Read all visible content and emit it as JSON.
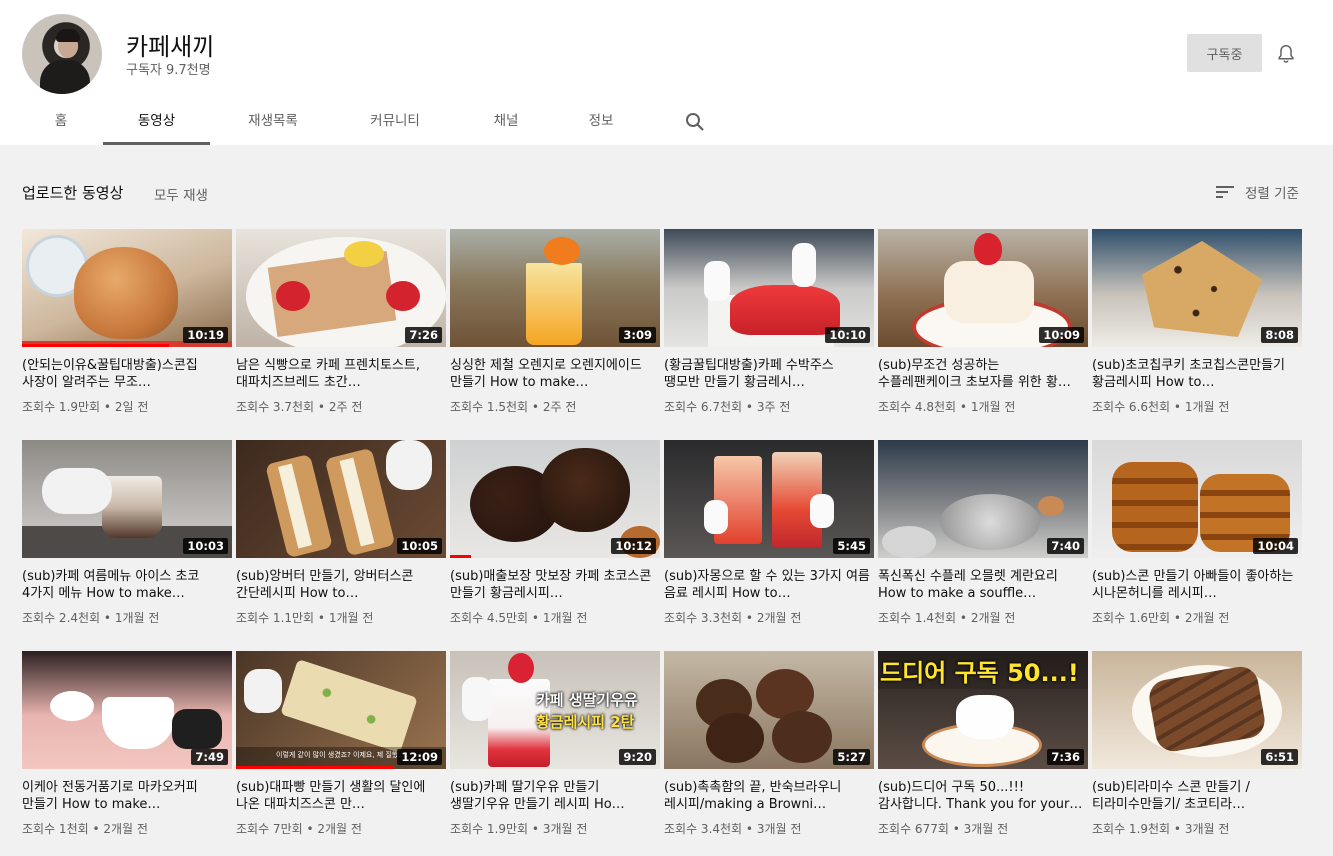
{
  "channel": {
    "name": "카페새끼",
    "subscribers": "구독자 9.7천명",
    "subscribe_label": "구독중"
  },
  "tabs": [
    {
      "label": "홈"
    },
    {
      "label": "동영상"
    },
    {
      "label": "재생목록"
    },
    {
      "label": "커뮤니티"
    },
    {
      "label": "채널"
    },
    {
      "label": "정보"
    }
  ],
  "section": {
    "title": "업로드한 동영상",
    "play_all": "모두 재생",
    "sort_label": "정렬 기준"
  },
  "videos": [
    {
      "title": "(안되는이유&꿀팁대방출)스콘집 사장이 알려주는 무조…",
      "views": "조회수 1.9만회",
      "age": "2일 전",
      "duration": "10:19",
      "watched": 0.7
    },
    {
      "title": "남은 식빵으로 카페 프렌치토스트, 대파치즈브레드 초간…",
      "views": "조회수 3.7천회",
      "age": "2주 전",
      "duration": "7:26",
      "watched": 0
    },
    {
      "title": "싱싱한 제철 오렌지로 오렌지에이드 만들기 How to make…",
      "views": "조회수 1.5천회",
      "age": "2주 전",
      "duration": "3:09",
      "watched": 0
    },
    {
      "title": "(황금꿀팁대방출)카페 수박주스 땡모반 만들기 황금레시…",
      "views": "조회수 6.7천회",
      "age": "3주 전",
      "duration": "10:10",
      "watched": 0
    },
    {
      "title": "(sub)무조건 성공하는 수플레팬케이크 초보자를 위한 황…",
      "views": "조회수 4.8천회",
      "age": "1개월 전",
      "duration": "10:09",
      "watched": 0
    },
    {
      "title": "(sub)초코칩쿠키 초코칩스콘만들기 황금레시피 How to…",
      "views": "조회수 6.6천회",
      "age": "1개월 전",
      "duration": "8:08",
      "watched": 0
    },
    {
      "title": "(sub)카페 여름메뉴 아이스 초코 4가지 메뉴 How to make…",
      "views": "조회수 2.4천회",
      "age": "1개월 전",
      "duration": "10:03",
      "watched": 0
    },
    {
      "title": "(sub)앙버터 만들기, 앙버터스콘 간단레시피 How to…",
      "views": "조회수 1.1만회",
      "age": "1개월 전",
      "duration": "10:05",
      "watched": 0
    },
    {
      "title": "(sub)매출보장 맛보장 카페 초코스콘 만들기 황금레시피…",
      "views": "조회수 4.5만회",
      "age": "1개월 전",
      "duration": "10:12",
      "watched": 0.1
    },
    {
      "title": "(sub)자몽으로 할 수 있는 3가지 여름 음료 레시피 How to…",
      "views": "조회수 3.3천회",
      "age": "2개월 전",
      "duration": "5:45",
      "watched": 0
    },
    {
      "title": "폭신폭신 수플레 오믈렛 계란요리 How to make a souffle…",
      "views": "조회수 1.4천회",
      "age": "2개월 전",
      "duration": "7:40",
      "watched": 0
    },
    {
      "title": "(sub)스콘 만들기 아빠들이 좋아하는 시나몬허니를 레시피…",
      "views": "조회수 1.6만회",
      "age": "2개월 전",
      "duration": "10:04",
      "watched": 0
    },
    {
      "title": "이케아 전동거품기로 마카오커피 만들기 How to make…",
      "views": "조회수 1천회",
      "age": "2개월 전",
      "duration": "7:49",
      "watched": 0
    },
    {
      "title": "(sub)대파빵 만들기 생활의 달인에 나온 대파치즈스콘 만…",
      "views": "조회수 7만회",
      "age": "2개월 전",
      "duration": "12:09",
      "watched": 0.75
    },
    {
      "title": "(sub)카페 딸기우유 만들기 생딸기우유 만들기 레시피 Ho…",
      "views": "조회수 1.9만회",
      "age": "3개월 전",
      "duration": "9:20",
      "watched": 0
    },
    {
      "title": "(sub)촉촉함의 끝, 반숙브라우니 레시피/making a Browni…",
      "views": "조회수 3.4천회",
      "age": "3개월 전",
      "duration": "5:27",
      "watched": 0
    },
    {
      "title": "(sub)드디어 구독 50...!!! 감사합니다. Thank you for your…",
      "views": "조회수 677회",
      "age": "3개월 전",
      "duration": "7:36",
      "watched": 0
    },
    {
      "title": "(sub)티라미수 스콘 만들기 / 티라미수만들기/ 초코티라…",
      "views": "조회수 1.9천회",
      "age": "3개월 전",
      "duration": "6:51",
      "watched": 0
    }
  ],
  "thumb_overlays": {
    "strawberry_milk_line1": "카페 생딸기우유",
    "strawberry_milk_line2": "황금레시피 2탄",
    "milestone": "드디어 구독 50...!",
    "scallion_caption": "이렇게 같이 많이 생겼죠? 이제요, 제 질했..."
  },
  "icons": [
    "bell-icon",
    "search-icon",
    "sort-icon"
  ]
}
